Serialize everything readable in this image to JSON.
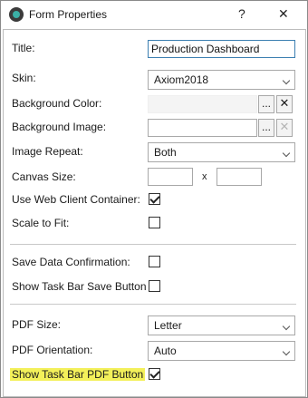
{
  "window": {
    "title": "Form Properties",
    "help_glyph": "?",
    "close_glyph": "✕"
  },
  "fields": {
    "title": {
      "label": "Title:",
      "value": "Production Dashboard"
    },
    "skin": {
      "label": "Skin:",
      "value": "Axiom2018"
    },
    "background_color": {
      "label": "Background Color:",
      "value": "",
      "browse": "...",
      "clear": "✕"
    },
    "background_image": {
      "label": "Background Image:",
      "value": "",
      "browse": "...",
      "clear": "✕"
    },
    "image_repeat": {
      "label": "Image Repeat:",
      "value": "Both"
    },
    "canvas_size": {
      "label": "Canvas Size:",
      "width": "",
      "height": "",
      "separator": "x"
    },
    "use_web_client_container": {
      "label": "Use Web Client Container:",
      "checked": true
    },
    "scale_to_fit": {
      "label": "Scale to Fit:",
      "checked": false
    },
    "save_data_confirmation": {
      "label": "Save Data Confirmation:",
      "checked": false
    },
    "show_task_bar_save_button": {
      "label": "Show Task Bar Save Button",
      "checked": false
    },
    "pdf_size": {
      "label": "PDF Size:",
      "value": "Letter"
    },
    "pdf_orientation": {
      "label": "PDF Orientation:",
      "value": "Auto"
    },
    "show_task_bar_pdf_button": {
      "label": "Show Task Bar PDF Button",
      "checked": true,
      "highlight_color": "#f3f05a"
    }
  },
  "colors": {
    "focus_border": "#3c7fb1",
    "highlight": "#f3f05a"
  }
}
